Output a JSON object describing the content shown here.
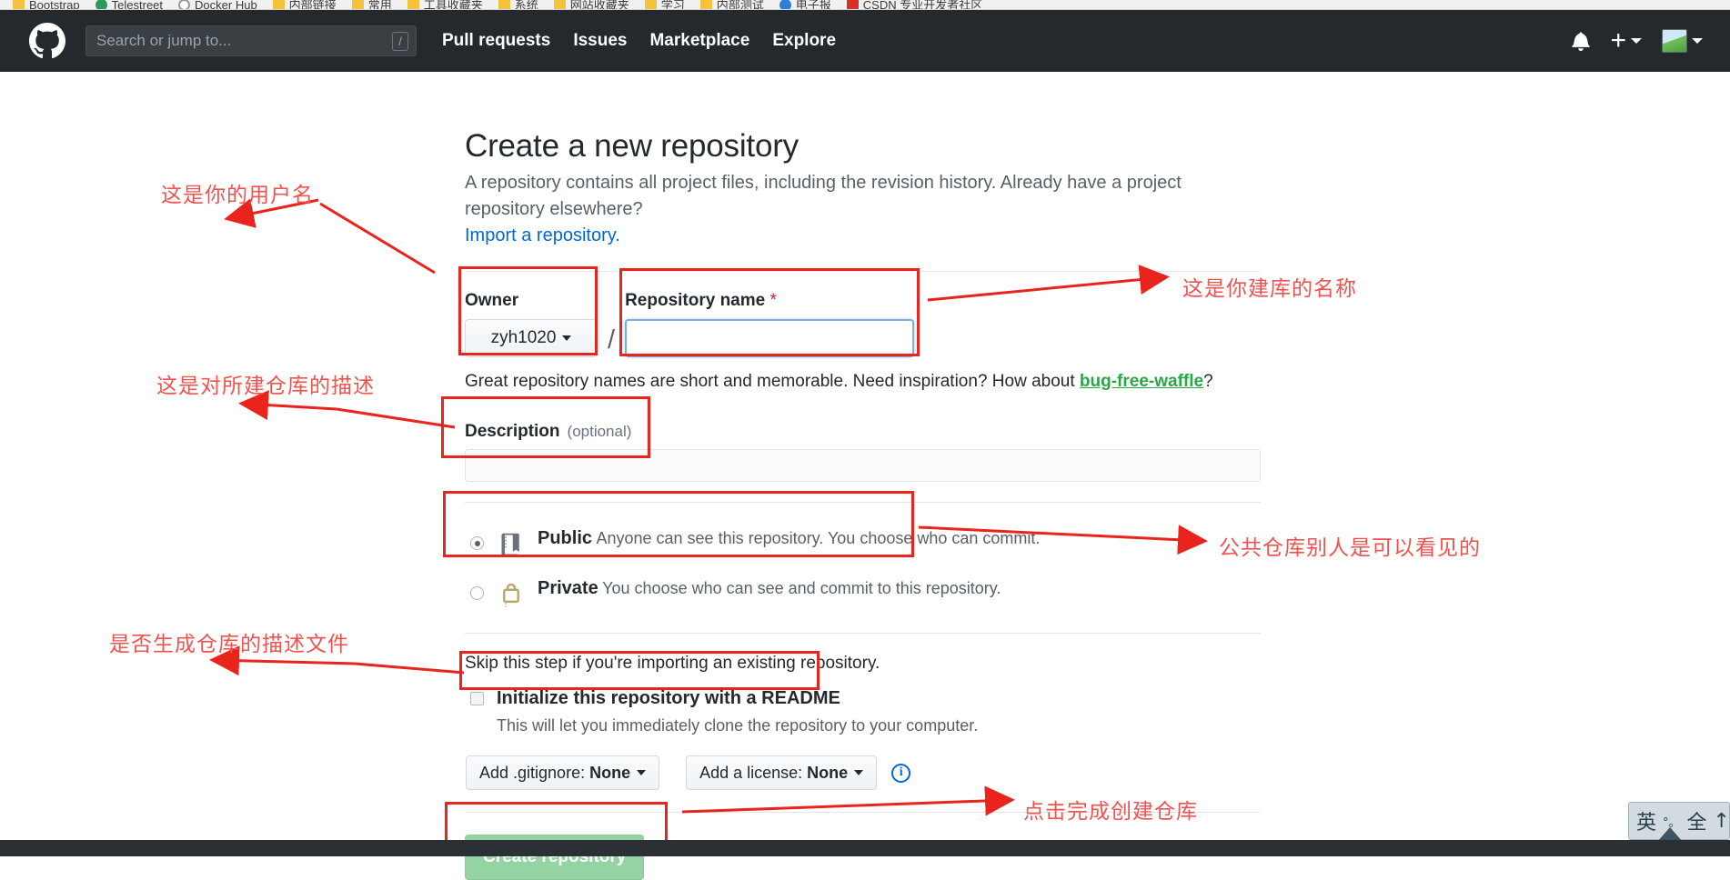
{
  "browser": {
    "bookmarks": [
      {
        "label": "Bootstrap",
        "icon": "folder-icon",
        "kind": "folder"
      },
      {
        "label": "Telestreet",
        "icon": "site-icon",
        "kind": "green"
      },
      {
        "label": "Docker Hub",
        "icon": "site-icon",
        "kind": "circ"
      },
      {
        "label": "内部链接",
        "icon": "folder-icon",
        "kind": "folder"
      },
      {
        "label": "常用",
        "icon": "folder-icon",
        "kind": "folder"
      },
      {
        "label": "工具收藏夹",
        "icon": "folder-icon",
        "kind": "folder"
      },
      {
        "label": "系统",
        "icon": "folder-icon",
        "kind": "folder"
      },
      {
        "label": "网站收藏夹",
        "icon": "folder-icon",
        "kind": "folder"
      },
      {
        "label": "学习",
        "icon": "folder-icon",
        "kind": "folder"
      },
      {
        "label": "内部测试",
        "icon": "folder-icon",
        "kind": "folder"
      },
      {
        "label": "电子报",
        "icon": "site-icon",
        "kind": "blue"
      },
      {
        "label": "CSDN 专业开发者社区",
        "icon": "site-icon",
        "kind": "red"
      }
    ]
  },
  "header": {
    "logo_icon": "github-mark-icon",
    "search": {
      "placeholder": "Search or jump to...",
      "value": "",
      "shortcut_hint": "/",
      "icon": "search-input"
    },
    "nav": [
      {
        "label": "Pull requests"
      },
      {
        "label": "Issues"
      },
      {
        "label": "Marketplace"
      },
      {
        "label": "Explore"
      }
    ],
    "right": {
      "notifications_icon": "bell-icon",
      "create_new_icon": "plus-icon",
      "avatar_icon": "avatar"
    }
  },
  "main": {
    "title": "Create a new repository",
    "subtitle": "A repository contains all project files, including the revision history. Already have a project repository elsewhere?",
    "import_link": "Import a repository.",
    "owner": {
      "label": "Owner",
      "value": "zyh1020",
      "separator": "/"
    },
    "repo_name": {
      "label": "Repository name",
      "required_marker": "*",
      "value": "",
      "placeholder": ""
    },
    "name_hint": {
      "prefix": "Great repository names are short and memorable. Need inspiration? How about ",
      "suggestion": "bug-free-waffle",
      "suffix": "?"
    },
    "description": {
      "label": "Description",
      "optional_note": "(optional)",
      "value": "",
      "placeholder": ""
    },
    "visibility": [
      {
        "id": "public",
        "title": "Public",
        "desc": "Anyone can see this repository. You choose who can commit.",
        "icon": "book-icon",
        "selected": true
      },
      {
        "id": "private",
        "title": "Private",
        "desc": "You choose who can see and commit to this repository.",
        "icon": "lock-icon",
        "selected": false
      }
    ],
    "readme": {
      "skip_note": "Skip this step if you're importing an existing repository.",
      "label": "Initialize this repository with a README",
      "sub": "This will let you immediately clone the repository to your computer.",
      "checked": false
    },
    "gitignore": {
      "prefix": "Add .gitignore:",
      "value": "None"
    },
    "license": {
      "prefix": "Add a license:",
      "value": "None",
      "info_icon": "info-icon",
      "info_glyph": "i"
    },
    "submit": {
      "label": "Create repository"
    }
  },
  "annotations": [
    {
      "id": "username",
      "text": "这是你的用户名"
    },
    {
      "id": "repo-name",
      "text": "这是你建库的名称"
    },
    {
      "id": "description",
      "text": "这是对所建仓库的描述"
    },
    {
      "id": "public",
      "text": "公共仓库别人是可以看见的"
    },
    {
      "id": "readme",
      "text": "是否生成仓库的描述文件"
    },
    {
      "id": "create",
      "text": "点击完成创建仓库"
    }
  ],
  "ime": {
    "mode": "英",
    "dots": "°。",
    "width_mode": "全",
    "extra": "↑"
  },
  "colors": {
    "header_bg": "#24292e",
    "annotation_red": "#ef5350",
    "highlight_box": "#e8241c",
    "link_blue": "#0366d6",
    "suggestion_green": "#28a745",
    "submit_green": "#94d3a2"
  }
}
